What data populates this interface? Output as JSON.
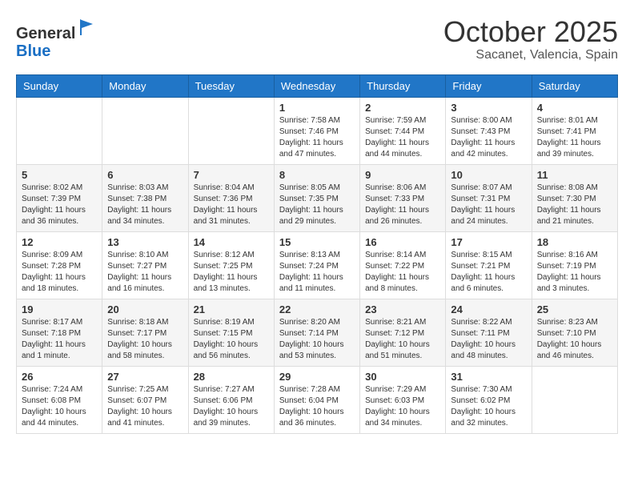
{
  "header": {
    "logo_general": "General",
    "logo_blue": "Blue",
    "month_title": "October 2025",
    "location": "Sacanet, Valencia, Spain"
  },
  "weekdays": [
    "Sunday",
    "Monday",
    "Tuesday",
    "Wednesday",
    "Thursday",
    "Friday",
    "Saturday"
  ],
  "weeks": [
    [
      {
        "day": "",
        "info": ""
      },
      {
        "day": "",
        "info": ""
      },
      {
        "day": "",
        "info": ""
      },
      {
        "day": "1",
        "info": "Sunrise: 7:58 AM\nSunset: 7:46 PM\nDaylight: 11 hours and 47 minutes."
      },
      {
        "day": "2",
        "info": "Sunrise: 7:59 AM\nSunset: 7:44 PM\nDaylight: 11 hours and 44 minutes."
      },
      {
        "day": "3",
        "info": "Sunrise: 8:00 AM\nSunset: 7:43 PM\nDaylight: 11 hours and 42 minutes."
      },
      {
        "day": "4",
        "info": "Sunrise: 8:01 AM\nSunset: 7:41 PM\nDaylight: 11 hours and 39 minutes."
      }
    ],
    [
      {
        "day": "5",
        "info": "Sunrise: 8:02 AM\nSunset: 7:39 PM\nDaylight: 11 hours and 36 minutes."
      },
      {
        "day": "6",
        "info": "Sunrise: 8:03 AM\nSunset: 7:38 PM\nDaylight: 11 hours and 34 minutes."
      },
      {
        "day": "7",
        "info": "Sunrise: 8:04 AM\nSunset: 7:36 PM\nDaylight: 11 hours and 31 minutes."
      },
      {
        "day": "8",
        "info": "Sunrise: 8:05 AM\nSunset: 7:35 PM\nDaylight: 11 hours and 29 minutes."
      },
      {
        "day": "9",
        "info": "Sunrise: 8:06 AM\nSunset: 7:33 PM\nDaylight: 11 hours and 26 minutes."
      },
      {
        "day": "10",
        "info": "Sunrise: 8:07 AM\nSunset: 7:31 PM\nDaylight: 11 hours and 24 minutes."
      },
      {
        "day": "11",
        "info": "Sunrise: 8:08 AM\nSunset: 7:30 PM\nDaylight: 11 hours and 21 minutes."
      }
    ],
    [
      {
        "day": "12",
        "info": "Sunrise: 8:09 AM\nSunset: 7:28 PM\nDaylight: 11 hours and 18 minutes."
      },
      {
        "day": "13",
        "info": "Sunrise: 8:10 AM\nSunset: 7:27 PM\nDaylight: 11 hours and 16 minutes."
      },
      {
        "day": "14",
        "info": "Sunrise: 8:12 AM\nSunset: 7:25 PM\nDaylight: 11 hours and 13 minutes."
      },
      {
        "day": "15",
        "info": "Sunrise: 8:13 AM\nSunset: 7:24 PM\nDaylight: 11 hours and 11 minutes."
      },
      {
        "day": "16",
        "info": "Sunrise: 8:14 AM\nSunset: 7:22 PM\nDaylight: 11 hours and 8 minutes."
      },
      {
        "day": "17",
        "info": "Sunrise: 8:15 AM\nSunset: 7:21 PM\nDaylight: 11 hours and 6 minutes."
      },
      {
        "day": "18",
        "info": "Sunrise: 8:16 AM\nSunset: 7:19 PM\nDaylight: 11 hours and 3 minutes."
      }
    ],
    [
      {
        "day": "19",
        "info": "Sunrise: 8:17 AM\nSunset: 7:18 PM\nDaylight: 11 hours and 1 minute."
      },
      {
        "day": "20",
        "info": "Sunrise: 8:18 AM\nSunset: 7:17 PM\nDaylight: 10 hours and 58 minutes."
      },
      {
        "day": "21",
        "info": "Sunrise: 8:19 AM\nSunset: 7:15 PM\nDaylight: 10 hours and 56 minutes."
      },
      {
        "day": "22",
        "info": "Sunrise: 8:20 AM\nSunset: 7:14 PM\nDaylight: 10 hours and 53 minutes."
      },
      {
        "day": "23",
        "info": "Sunrise: 8:21 AM\nSunset: 7:12 PM\nDaylight: 10 hours and 51 minutes."
      },
      {
        "day": "24",
        "info": "Sunrise: 8:22 AM\nSunset: 7:11 PM\nDaylight: 10 hours and 48 minutes."
      },
      {
        "day": "25",
        "info": "Sunrise: 8:23 AM\nSunset: 7:10 PM\nDaylight: 10 hours and 46 minutes."
      }
    ],
    [
      {
        "day": "26",
        "info": "Sunrise: 7:24 AM\nSunset: 6:08 PM\nDaylight: 10 hours and 44 minutes."
      },
      {
        "day": "27",
        "info": "Sunrise: 7:25 AM\nSunset: 6:07 PM\nDaylight: 10 hours and 41 minutes."
      },
      {
        "day": "28",
        "info": "Sunrise: 7:27 AM\nSunset: 6:06 PM\nDaylight: 10 hours and 39 minutes."
      },
      {
        "day": "29",
        "info": "Sunrise: 7:28 AM\nSunset: 6:04 PM\nDaylight: 10 hours and 36 minutes."
      },
      {
        "day": "30",
        "info": "Sunrise: 7:29 AM\nSunset: 6:03 PM\nDaylight: 10 hours and 34 minutes."
      },
      {
        "day": "31",
        "info": "Sunrise: 7:30 AM\nSunset: 6:02 PM\nDaylight: 10 hours and 32 minutes."
      },
      {
        "day": "",
        "info": ""
      }
    ]
  ]
}
